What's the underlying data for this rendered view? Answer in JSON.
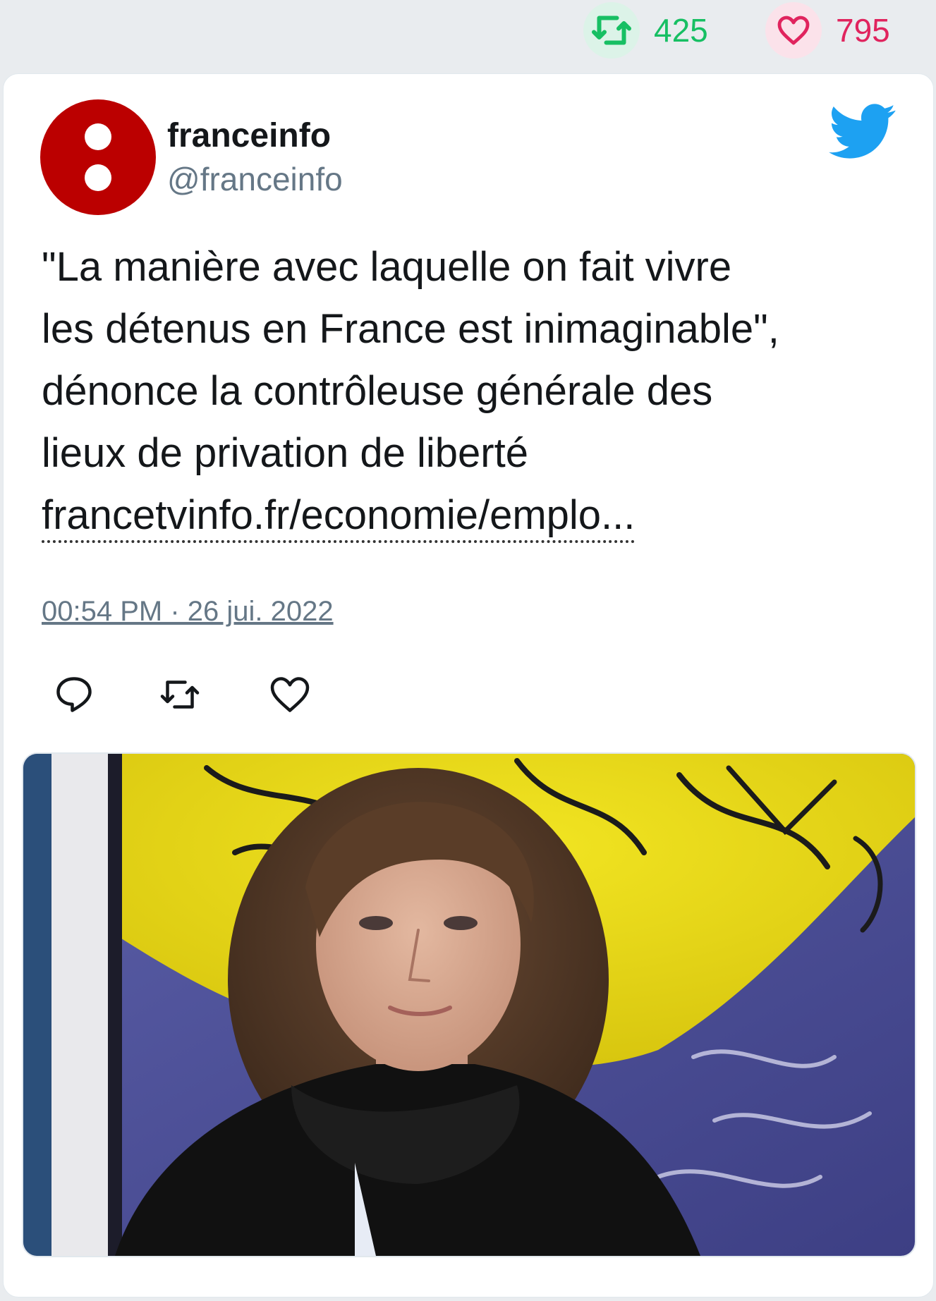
{
  "stats": {
    "retweets": "425",
    "likes": "795"
  },
  "tweet": {
    "display_name": "franceinfo",
    "handle": "@franceinfo",
    "text_lines": [
      "\"La manière avec laquelle on fait vivre",
      "les détenus en France est inimaginable\",",
      "dénonce la contrôleuse générale des",
      "lieux de privation de liberté"
    ],
    "link": "francetvinfo.fr/economie/emplo...",
    "timestamp": "00:54 PM · 26 jui. 2022"
  },
  "icons": {
    "retweet": "retweet-icon",
    "like": "heart-icon",
    "reply": "reply-icon",
    "brand": "twitter-bird-icon"
  },
  "colors": {
    "retweet_green": "#17bf63",
    "like_red": "#e0245e",
    "twitter_blue": "#1da1f2",
    "avatar_red": "#bb0000"
  }
}
